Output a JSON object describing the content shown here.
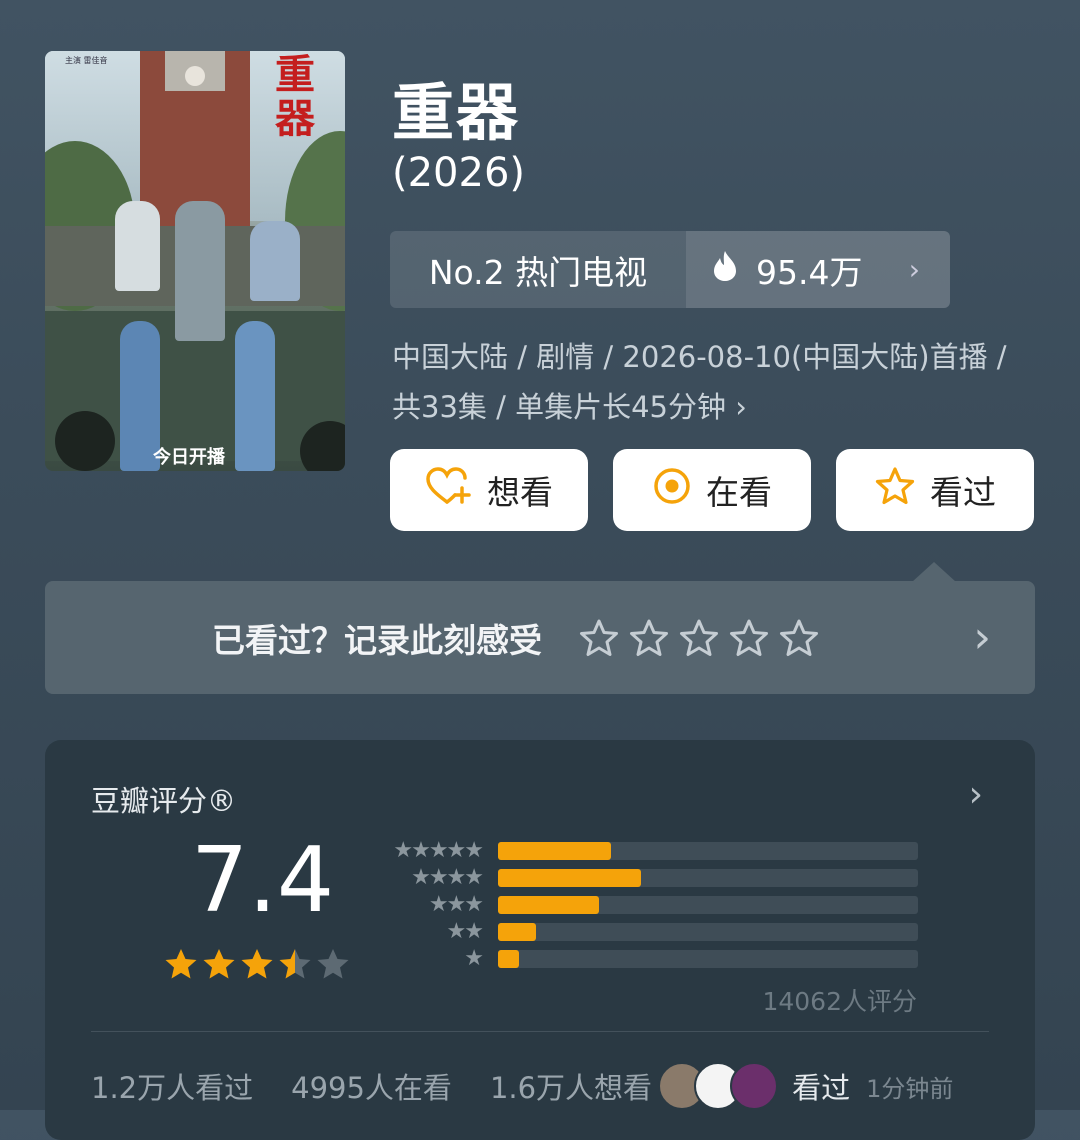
{
  "movie": {
    "title": "重器",
    "year": "(2026)",
    "poster": {
      "title_text": "重器",
      "tag": "今日开播",
      "credit": "主演 雷佳音"
    },
    "rank_label": "No.2 热门电视",
    "heat": "95.4万",
    "meta": "中国大陆 / 剧情 / 2026-08-10(中国大陆)首播 / 共33集 / 单集片长45分钟 ›"
  },
  "actions": {
    "want": "想看",
    "watching": "在看",
    "watched": "看过"
  },
  "record": {
    "prompt": "已看过？记录此刻感受"
  },
  "rating": {
    "label": "豆瓣评分®",
    "score": "7.4",
    "stars_filled": 3.5,
    "distribution_percent": [
      27,
      34,
      24,
      9,
      5
    ],
    "count": "14062人评分"
  },
  "stats": {
    "watched": "1.2万人看过",
    "watching": "4995人在看",
    "want": "1.6万人想看",
    "recent_label": "看过",
    "recent_time": "1分钟前"
  },
  "colors": {
    "accent": "#f5a30a",
    "bg": "#3b4c5a"
  }
}
